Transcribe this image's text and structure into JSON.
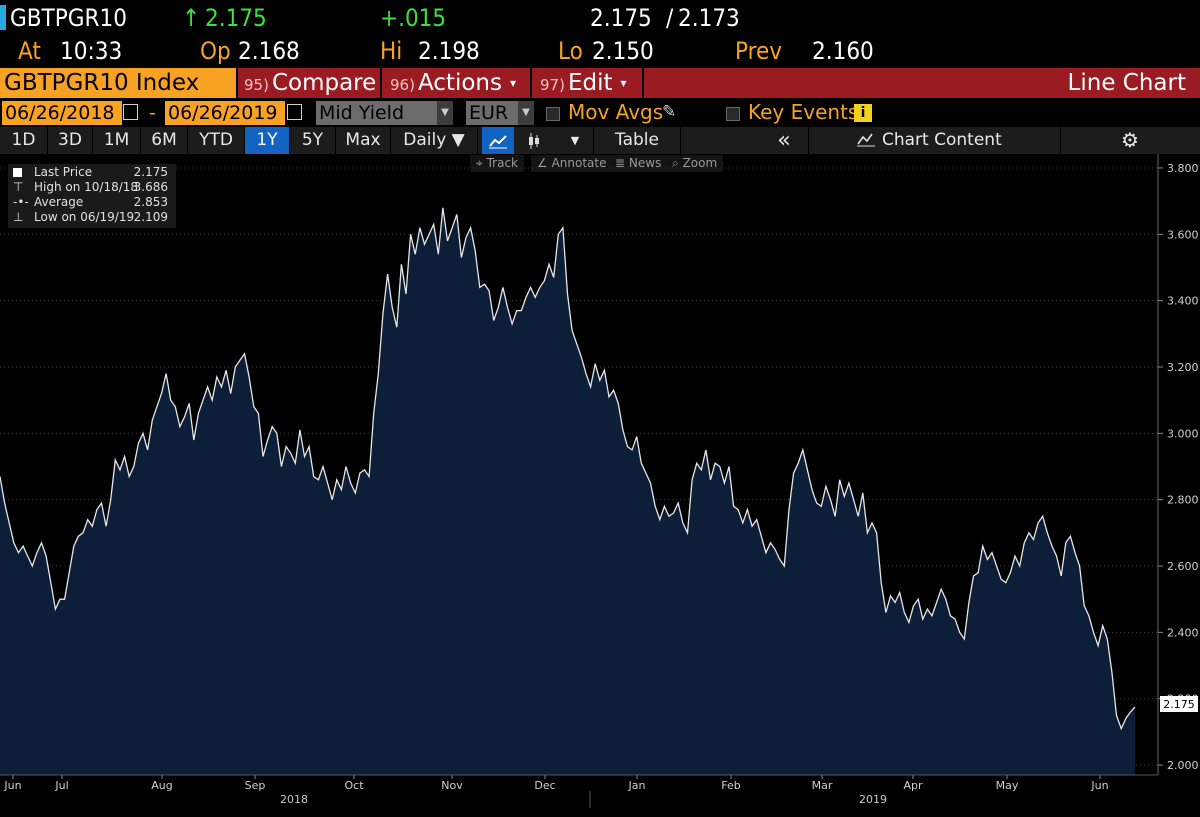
{
  "header": {
    "ticker": "GBTPGR10",
    "arrow": "↑",
    "last": "2.175",
    "change": "+.015",
    "bid": "2.175",
    "slash": "/",
    "ask": "2.173",
    "at_label": "At",
    "time": "10:33",
    "open_label": "Op",
    "open": "2.168",
    "high_label": "Hi",
    "high": "2.198",
    "low_label": "Lo",
    "low": "2.150",
    "prev_label": "Prev",
    "prev": "2.160"
  },
  "command_bar": {
    "security": "GBTPGR10 Index",
    "compare_num": "95)",
    "compare": "Compare",
    "actions_num": "96)",
    "actions": "Actions",
    "edit_num": "97)",
    "edit": "Edit",
    "caret": "▾",
    "view": "Line Chart"
  },
  "date_row": {
    "start": "06/26/2018",
    "dash": "-",
    "end": "06/26/2019",
    "field": "Mid Yield",
    "currency": "EUR",
    "mov_avgs": "Mov Avgs",
    "key_events": "Key Events",
    "info": "i"
  },
  "toolbar": {
    "periods": [
      "1D",
      "3D",
      "1M",
      "6M",
      "YTD",
      "1Y",
      "5Y",
      "Max"
    ],
    "active_period": "1Y",
    "frequency": "Daily ▼",
    "table": "Table",
    "collapse": "«",
    "chart_content": "Chart Content",
    "settings_icon": "gear-icon"
  },
  "sub_toolbar": {
    "track": "Track",
    "annotate": "Annotate",
    "news": "News",
    "zoom": "Zoom"
  },
  "legend": {
    "items": [
      {
        "label": "Last Price",
        "value": "2.175"
      },
      {
        "label": "High on 10/18/18",
        "value": "3.686"
      },
      {
        "label": "Average",
        "value": "2.853"
      },
      {
        "label": "Low on 06/19/19",
        "value": "2.109"
      }
    ]
  },
  "colors": {
    "accent_orange": "#f7a223",
    "command_red": "#9b1b22",
    "up_green": "#3ee03e",
    "active_blue": "#1364c2",
    "area_fill": "#0d1e38"
  },
  "chart_data": {
    "type": "area",
    "title": "",
    "xlabel": "",
    "ylabel": "",
    "ylim": [
      1.97,
      3.83
    ],
    "y_ticks": [
      "2.000",
      "2.200",
      "2.400",
      "2.600",
      "2.800",
      "3.000",
      "3.200",
      "3.400",
      "3.600",
      "3.800"
    ],
    "x_ticks": [
      "Jun",
      "Jul",
      "Aug",
      "Sep",
      "Oct",
      "Nov",
      "Dec",
      "Jan",
      "Feb",
      "Mar",
      "Apr",
      "May",
      "Jun"
    ],
    "year_labels": [
      "2018",
      "2019"
    ],
    "last_label": "2.175",
    "series": [
      {
        "values": [
          2.87,
          2.79,
          2.73,
          2.67,
          2.64,
          2.66,
          2.63,
          2.6,
          2.64,
          2.67,
          2.63,
          2.55,
          2.47,
          2.5,
          2.5,
          2.58,
          2.66,
          2.69,
          2.7,
          2.74,
          2.72,
          2.77,
          2.79,
          2.72,
          2.8,
          2.92,
          2.89,
          2.93,
          2.87,
          2.9,
          2.97,
          3.0,
          2.95,
          3.04,
          3.08,
          3.12,
          3.18,
          3.1,
          3.08,
          3.02,
          3.05,
          3.09,
          2.98,
          3.06,
          3.1,
          3.14,
          3.1,
          3.17,
          3.14,
          3.19,
          3.12,
          3.2,
          3.22,
          3.24,
          3.17,
          3.08,
          3.06,
          2.93,
          2.98,
          3.02,
          3.0,
          2.9,
          2.96,
          2.94,
          2.91,
          3.01,
          2.93,
          2.96,
          2.87,
          2.86,
          2.9,
          2.85,
          2.8,
          2.86,
          2.83,
          2.9,
          2.85,
          2.82,
          2.88,
          2.89,
          2.87,
          3.06,
          3.18,
          3.36,
          3.48,
          3.38,
          3.32,
          3.51,
          3.42,
          3.6,
          3.54,
          3.62,
          3.57,
          3.6,
          3.63,
          3.54,
          3.68,
          3.58,
          3.62,
          3.66,
          3.53,
          3.59,
          3.62,
          3.55,
          3.44,
          3.45,
          3.43,
          3.34,
          3.38,
          3.44,
          3.38,
          3.33,
          3.37,
          3.37,
          3.41,
          3.44,
          3.41,
          3.44,
          3.46,
          3.51,
          3.47,
          3.6,
          3.62,
          3.42,
          3.31,
          3.27,
          3.23,
          3.18,
          3.14,
          3.21,
          3.16,
          3.19,
          3.11,
          3.13,
          3.09,
          3.01,
          2.96,
          2.95,
          2.99,
          2.91,
          2.88,
          2.85,
          2.78,
          2.74,
          2.78,
          2.75,
          2.76,
          2.79,
          2.73,
          2.7,
          2.86,
          2.91,
          2.89,
          2.95,
          2.86,
          2.91,
          2.9,
          2.85,
          2.9,
          2.78,
          2.77,
          2.73,
          2.77,
          2.72,
          2.74,
          2.69,
          2.64,
          2.67,
          2.65,
          2.62,
          2.6,
          2.77,
          2.88,
          2.91,
          2.95,
          2.89,
          2.83,
          2.79,
          2.78,
          2.84,
          2.8,
          2.75,
          2.86,
          2.81,
          2.85,
          2.8,
          2.75,
          2.82,
          2.7,
          2.73,
          2.7,
          2.55,
          2.46,
          2.51,
          2.49,
          2.52,
          2.46,
          2.43,
          2.48,
          2.5,
          2.44,
          2.47,
          2.45,
          2.49,
          2.53,
          2.5,
          2.45,
          2.44,
          2.4,
          2.38,
          2.49,
          2.57,
          2.58,
          2.66,
          2.62,
          2.64,
          2.6,
          2.56,
          2.55,
          2.58,
          2.63,
          2.6,
          2.67,
          2.7,
          2.68,
          2.73,
          2.75,
          2.7,
          2.66,
          2.63,
          2.57,
          2.67,
          2.69,
          2.64,
          2.6,
          2.48,
          2.45,
          2.4,
          2.36,
          2.42,
          2.38,
          2.28,
          2.15,
          2.11,
          2.14,
          2.16,
          2.175
        ]
      }
    ]
  }
}
